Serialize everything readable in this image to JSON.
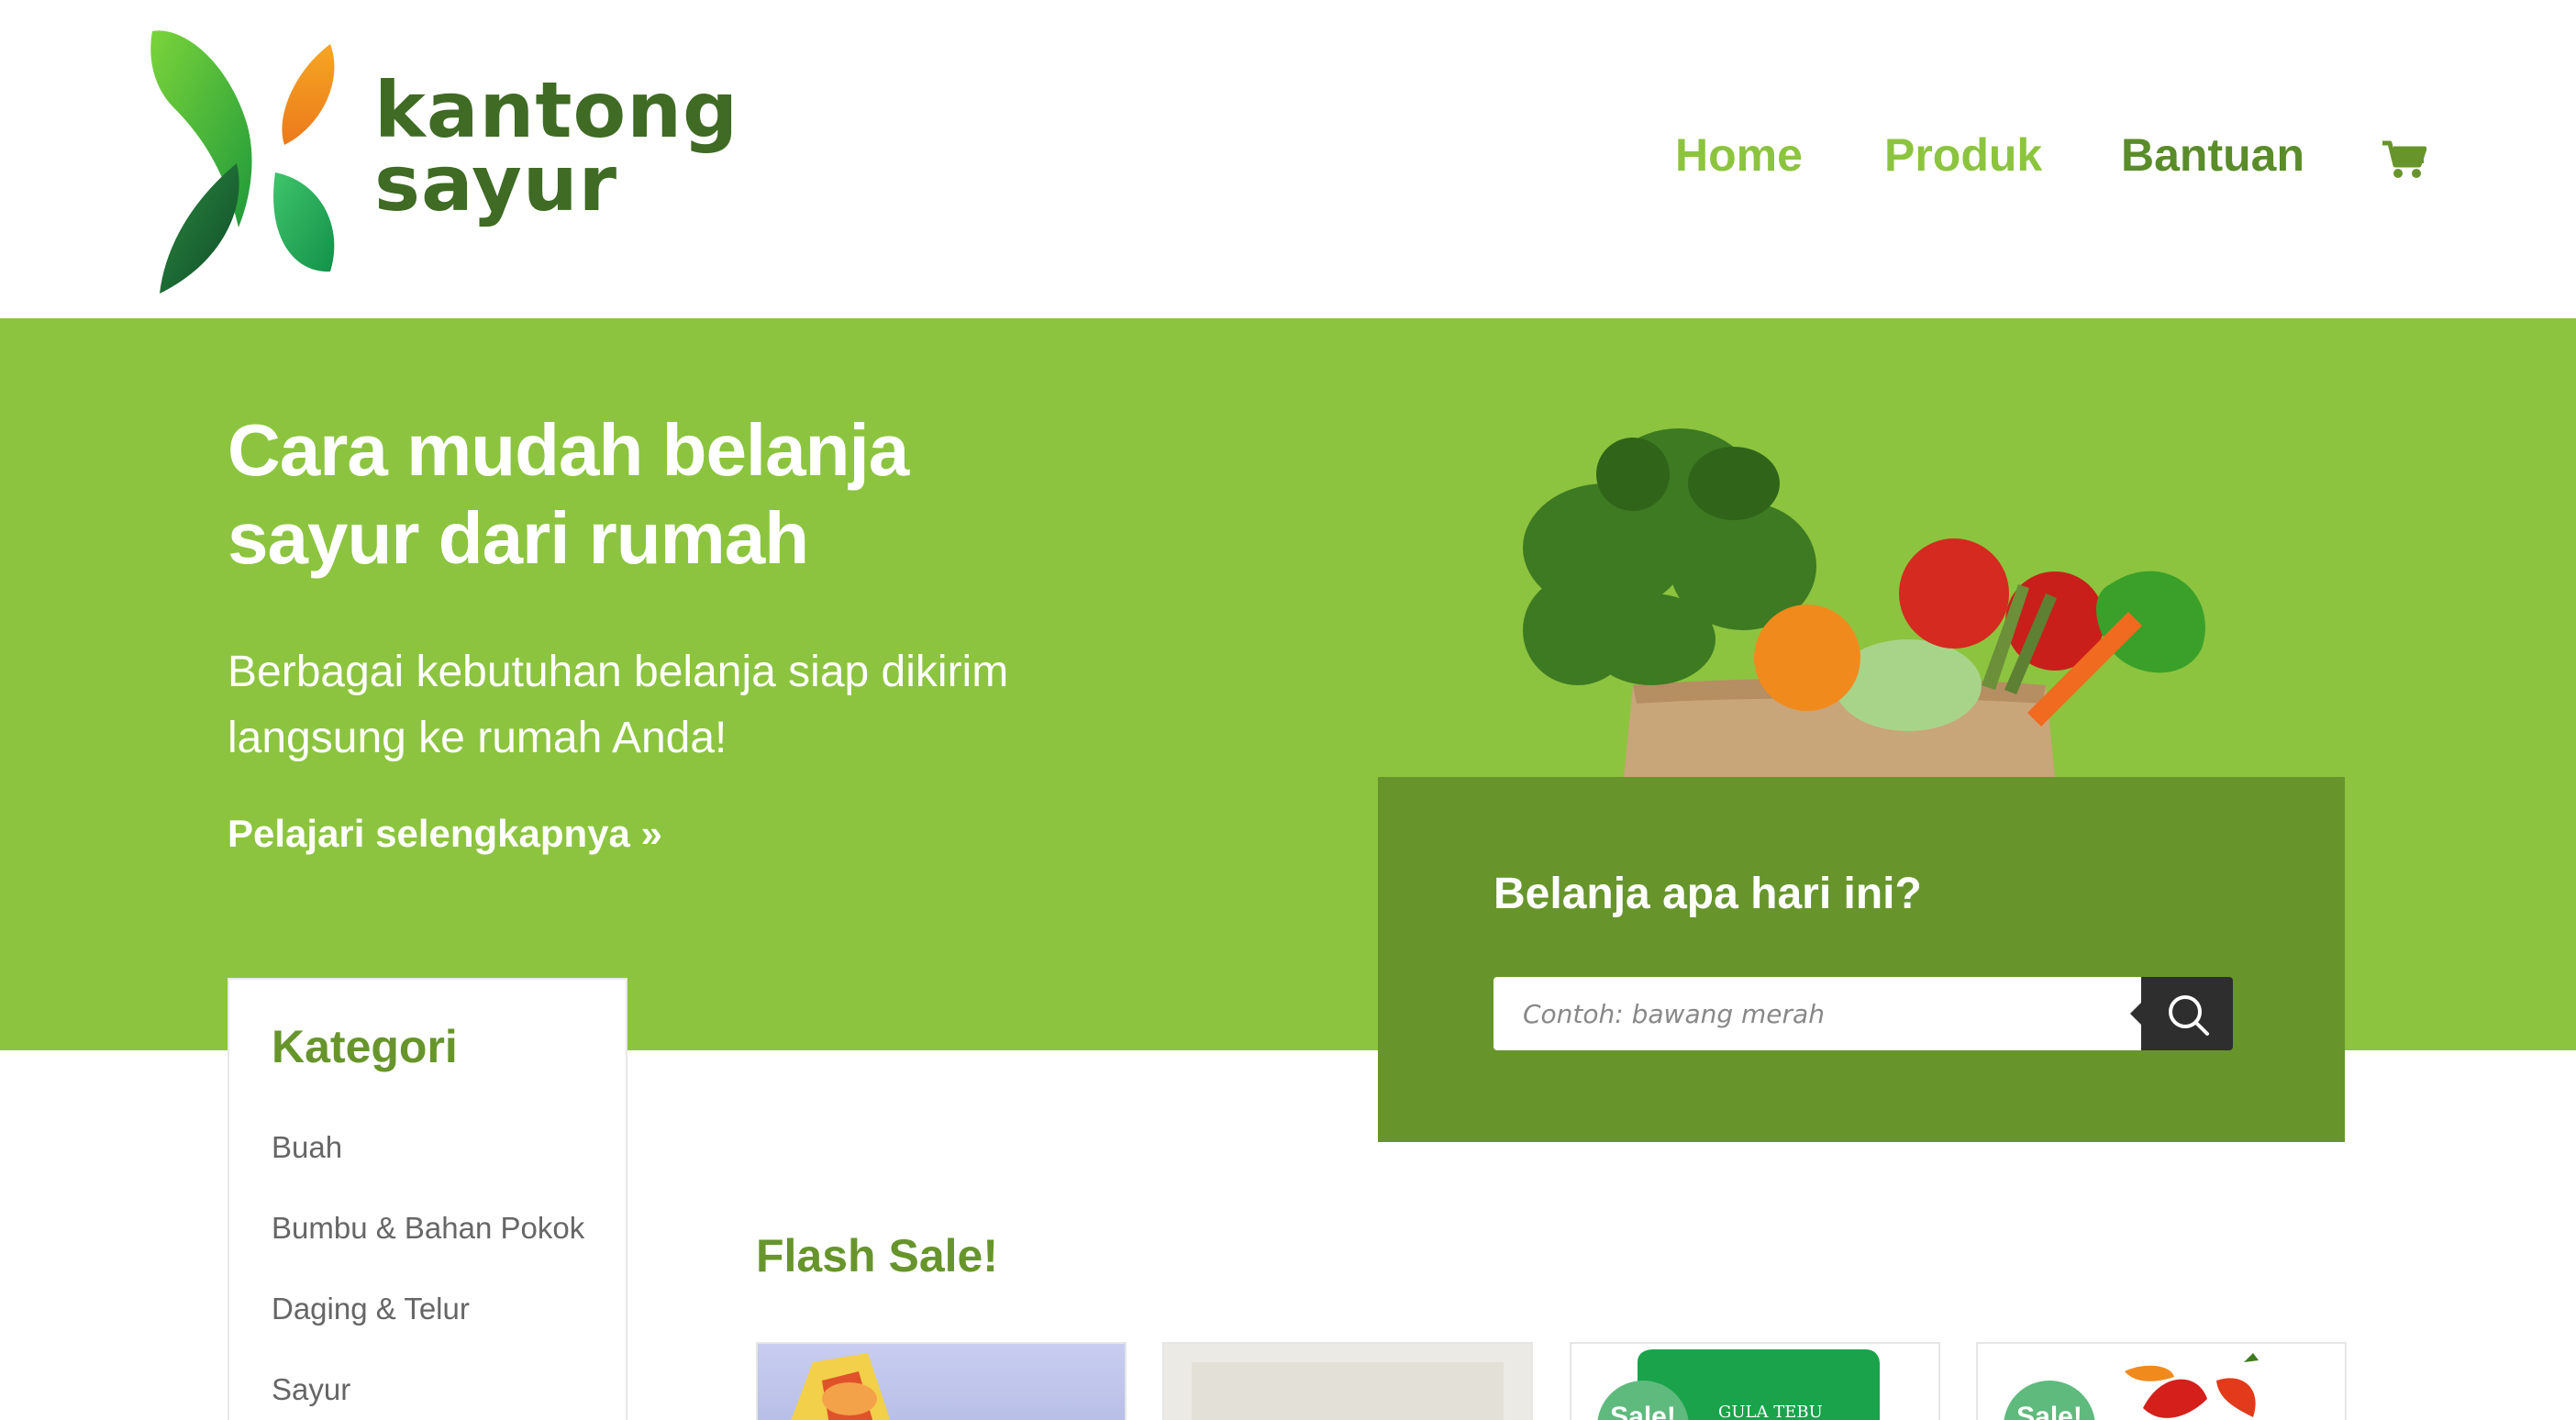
{
  "brand": {
    "line1": "kantong",
    "line2": "sayur",
    "colors": {
      "primary": "#8cc43f",
      "dark": "#67952c",
      "text": "#3f6b24"
    }
  },
  "nav": {
    "home": "Home",
    "produk": "Produk",
    "bantuan": "Bantuan",
    "cart_icon": "shopping-cart-icon"
  },
  "hero": {
    "title_line1": "Cara mudah belanja",
    "title_line2": "sayur dari rumah",
    "subtitle_line1": "Berbagai kebutuhan belanja siap dikirim",
    "subtitle_line2": "langsung ke rumah Anda!",
    "link": "Pelajari selengkapnya »"
  },
  "search": {
    "title": "Belanja apa hari ini?",
    "placeholder": "Contoh: bawang merah",
    "button_icon": "search-icon"
  },
  "kategori": {
    "title": "Kategori",
    "items": [
      "Buah",
      "Bumbu & Bahan Pokok",
      "Daging & Telur",
      "Sayur"
    ]
  },
  "flash_sale": {
    "title": "Flash Sale!",
    "badge": "Sale!",
    "product_label_3": "GULA TEBU"
  }
}
